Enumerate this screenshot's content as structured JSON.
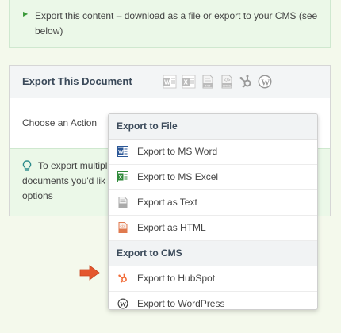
{
  "intro": {
    "text": "Export this content – download as a file or export to your CMS (see below)"
  },
  "panel": {
    "title": "Export This Document",
    "icons": [
      "word-icon",
      "excel-icon",
      "text-icon",
      "html-icon",
      "hubspot-icon",
      "wordpress-icon"
    ],
    "choose_label": "Choose an Action"
  },
  "info": {
    "lines": [
      "To export multipl",
      "documents you'd lik",
      "options"
    ]
  },
  "dropdown": {
    "group_file": "Export to File",
    "items_file": [
      {
        "label": "Export to MS Word",
        "icon": "word-icon"
      },
      {
        "label": "Export to MS Excel",
        "icon": "excel-icon"
      },
      {
        "label": "Export as Text",
        "icon": "text-icon"
      },
      {
        "label": "Export as HTML",
        "icon": "html-icon"
      }
    ],
    "group_cms": "Export to CMS",
    "items_cms": [
      {
        "label": "Export to HubSpot",
        "icon": "hubspot-icon"
      },
      {
        "label": "Export to WordPress",
        "icon": "wordpress-icon"
      }
    ]
  },
  "colors": {
    "word": "#2b5797",
    "excel": "#2f8a3a",
    "hubspot": "#f26a36",
    "wordpress": "#444444",
    "pointer": "#e4572e",
    "accent_green": "#3a9a3a"
  }
}
